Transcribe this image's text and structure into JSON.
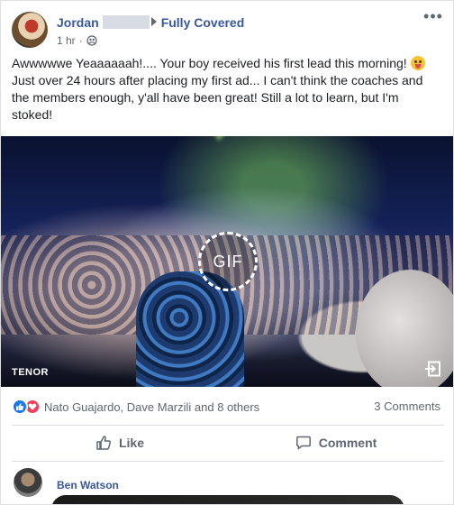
{
  "post": {
    "author_first_name": "Jordan",
    "group_name": "Fully Covered",
    "timestamp": "1 hr",
    "dot": "·",
    "text": "Awwwwwe Yeaaaaaah!.... Your boy received his first lead this morning! ",
    "text_after": "Just over 24 hours after placing my first ad... I can't think the coaches and the members enough, y'all have been great! Still a lot to learn, but I'm stoked!",
    "more_glyph": "•••"
  },
  "gif": {
    "badge": "GIF",
    "provider": "TENOR"
  },
  "reactions": {
    "summary": "Nato Guajardo, Dave Marzili and 8 others",
    "comments": "3 Comments"
  },
  "actions": {
    "like_label": "Like",
    "comment_label": "Comment"
  },
  "comment": {
    "author": "Ben Watson"
  },
  "colors": {
    "link": "#385898",
    "like_blue": "#1877f2",
    "love_red": "#f33e58"
  }
}
